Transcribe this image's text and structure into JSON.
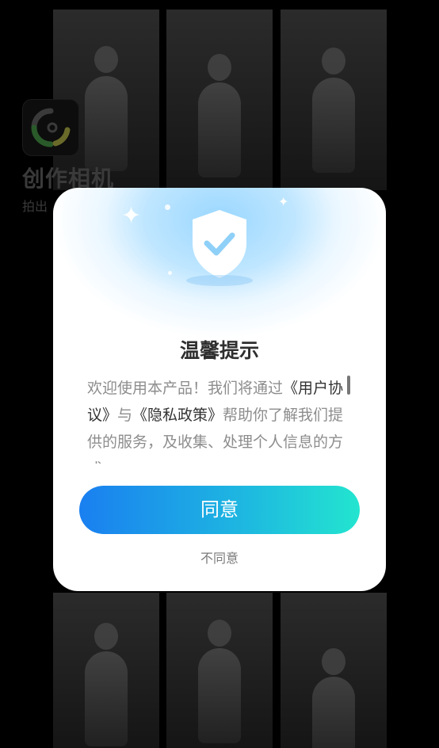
{
  "app": {
    "name": "创作相机",
    "slogan": "拍出"
  },
  "dialog": {
    "title": "温馨提示",
    "body_before": "欢迎使用本产品！我们将通过",
    "user_agreement": "《用户协议》",
    "body_and": "与",
    "privacy_policy": "《隐私政策》",
    "body_after": "帮助你了解我们提供的服务，及收集、处理个人信息的方式",
    "agree_label": "同意",
    "disagree_label": "不同意"
  },
  "colors": {
    "agree_gradient_start": "#1a7ff0",
    "agree_gradient_end": "#23e5cf",
    "shield": "#ffffff",
    "check": "#8fd0f8"
  },
  "icons": {
    "logo": "camera-lens-logo-icon",
    "shield": "shield-check-icon"
  }
}
